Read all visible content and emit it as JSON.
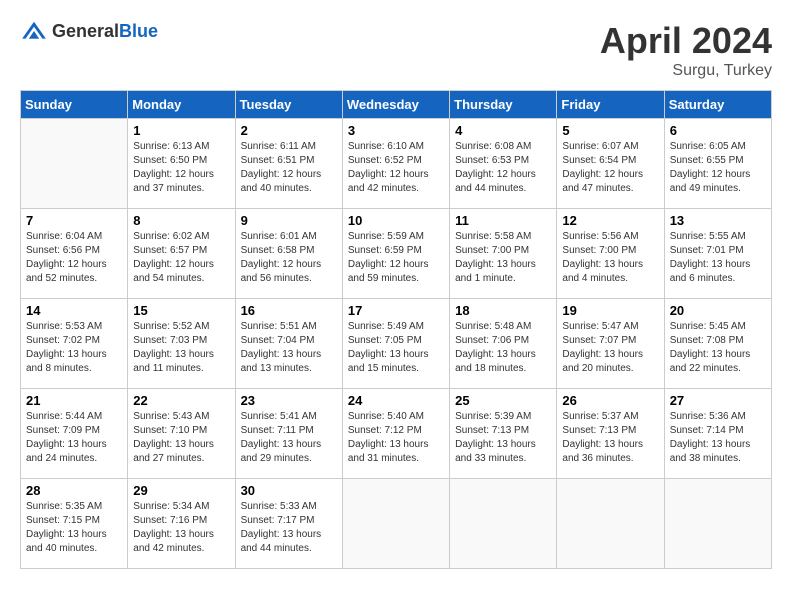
{
  "header": {
    "logo_general": "General",
    "logo_blue": "Blue",
    "month_title": "April 2024",
    "location": "Surgu, Turkey"
  },
  "days_of_week": [
    "Sunday",
    "Monday",
    "Tuesday",
    "Wednesday",
    "Thursday",
    "Friday",
    "Saturday"
  ],
  "weeks": [
    [
      {
        "day": "",
        "info": ""
      },
      {
        "day": "1",
        "info": "Sunrise: 6:13 AM\nSunset: 6:50 PM\nDaylight: 12 hours\nand 37 minutes."
      },
      {
        "day": "2",
        "info": "Sunrise: 6:11 AM\nSunset: 6:51 PM\nDaylight: 12 hours\nand 40 minutes."
      },
      {
        "day": "3",
        "info": "Sunrise: 6:10 AM\nSunset: 6:52 PM\nDaylight: 12 hours\nand 42 minutes."
      },
      {
        "day": "4",
        "info": "Sunrise: 6:08 AM\nSunset: 6:53 PM\nDaylight: 12 hours\nand 44 minutes."
      },
      {
        "day": "5",
        "info": "Sunrise: 6:07 AM\nSunset: 6:54 PM\nDaylight: 12 hours\nand 47 minutes."
      },
      {
        "day": "6",
        "info": "Sunrise: 6:05 AM\nSunset: 6:55 PM\nDaylight: 12 hours\nand 49 minutes."
      }
    ],
    [
      {
        "day": "7",
        "info": "Sunrise: 6:04 AM\nSunset: 6:56 PM\nDaylight: 12 hours\nand 52 minutes."
      },
      {
        "day": "8",
        "info": "Sunrise: 6:02 AM\nSunset: 6:57 PM\nDaylight: 12 hours\nand 54 minutes."
      },
      {
        "day": "9",
        "info": "Sunrise: 6:01 AM\nSunset: 6:58 PM\nDaylight: 12 hours\nand 56 minutes."
      },
      {
        "day": "10",
        "info": "Sunrise: 5:59 AM\nSunset: 6:59 PM\nDaylight: 12 hours\nand 59 minutes."
      },
      {
        "day": "11",
        "info": "Sunrise: 5:58 AM\nSunset: 7:00 PM\nDaylight: 13 hours\nand 1 minute."
      },
      {
        "day": "12",
        "info": "Sunrise: 5:56 AM\nSunset: 7:00 PM\nDaylight: 13 hours\nand 4 minutes."
      },
      {
        "day": "13",
        "info": "Sunrise: 5:55 AM\nSunset: 7:01 PM\nDaylight: 13 hours\nand 6 minutes."
      }
    ],
    [
      {
        "day": "14",
        "info": "Sunrise: 5:53 AM\nSunset: 7:02 PM\nDaylight: 13 hours\nand 8 minutes."
      },
      {
        "day": "15",
        "info": "Sunrise: 5:52 AM\nSunset: 7:03 PM\nDaylight: 13 hours\nand 11 minutes."
      },
      {
        "day": "16",
        "info": "Sunrise: 5:51 AM\nSunset: 7:04 PM\nDaylight: 13 hours\nand 13 minutes."
      },
      {
        "day": "17",
        "info": "Sunrise: 5:49 AM\nSunset: 7:05 PM\nDaylight: 13 hours\nand 15 minutes."
      },
      {
        "day": "18",
        "info": "Sunrise: 5:48 AM\nSunset: 7:06 PM\nDaylight: 13 hours\nand 18 minutes."
      },
      {
        "day": "19",
        "info": "Sunrise: 5:47 AM\nSunset: 7:07 PM\nDaylight: 13 hours\nand 20 minutes."
      },
      {
        "day": "20",
        "info": "Sunrise: 5:45 AM\nSunset: 7:08 PM\nDaylight: 13 hours\nand 22 minutes."
      }
    ],
    [
      {
        "day": "21",
        "info": "Sunrise: 5:44 AM\nSunset: 7:09 PM\nDaylight: 13 hours\nand 24 minutes."
      },
      {
        "day": "22",
        "info": "Sunrise: 5:43 AM\nSunset: 7:10 PM\nDaylight: 13 hours\nand 27 minutes."
      },
      {
        "day": "23",
        "info": "Sunrise: 5:41 AM\nSunset: 7:11 PM\nDaylight: 13 hours\nand 29 minutes."
      },
      {
        "day": "24",
        "info": "Sunrise: 5:40 AM\nSunset: 7:12 PM\nDaylight: 13 hours\nand 31 minutes."
      },
      {
        "day": "25",
        "info": "Sunrise: 5:39 AM\nSunset: 7:13 PM\nDaylight: 13 hours\nand 33 minutes."
      },
      {
        "day": "26",
        "info": "Sunrise: 5:37 AM\nSunset: 7:13 PM\nDaylight: 13 hours\nand 36 minutes."
      },
      {
        "day": "27",
        "info": "Sunrise: 5:36 AM\nSunset: 7:14 PM\nDaylight: 13 hours\nand 38 minutes."
      }
    ],
    [
      {
        "day": "28",
        "info": "Sunrise: 5:35 AM\nSunset: 7:15 PM\nDaylight: 13 hours\nand 40 minutes."
      },
      {
        "day": "29",
        "info": "Sunrise: 5:34 AM\nSunset: 7:16 PM\nDaylight: 13 hours\nand 42 minutes."
      },
      {
        "day": "30",
        "info": "Sunrise: 5:33 AM\nSunset: 7:17 PM\nDaylight: 13 hours\nand 44 minutes."
      },
      {
        "day": "",
        "info": ""
      },
      {
        "day": "",
        "info": ""
      },
      {
        "day": "",
        "info": ""
      },
      {
        "day": "",
        "info": ""
      }
    ]
  ]
}
